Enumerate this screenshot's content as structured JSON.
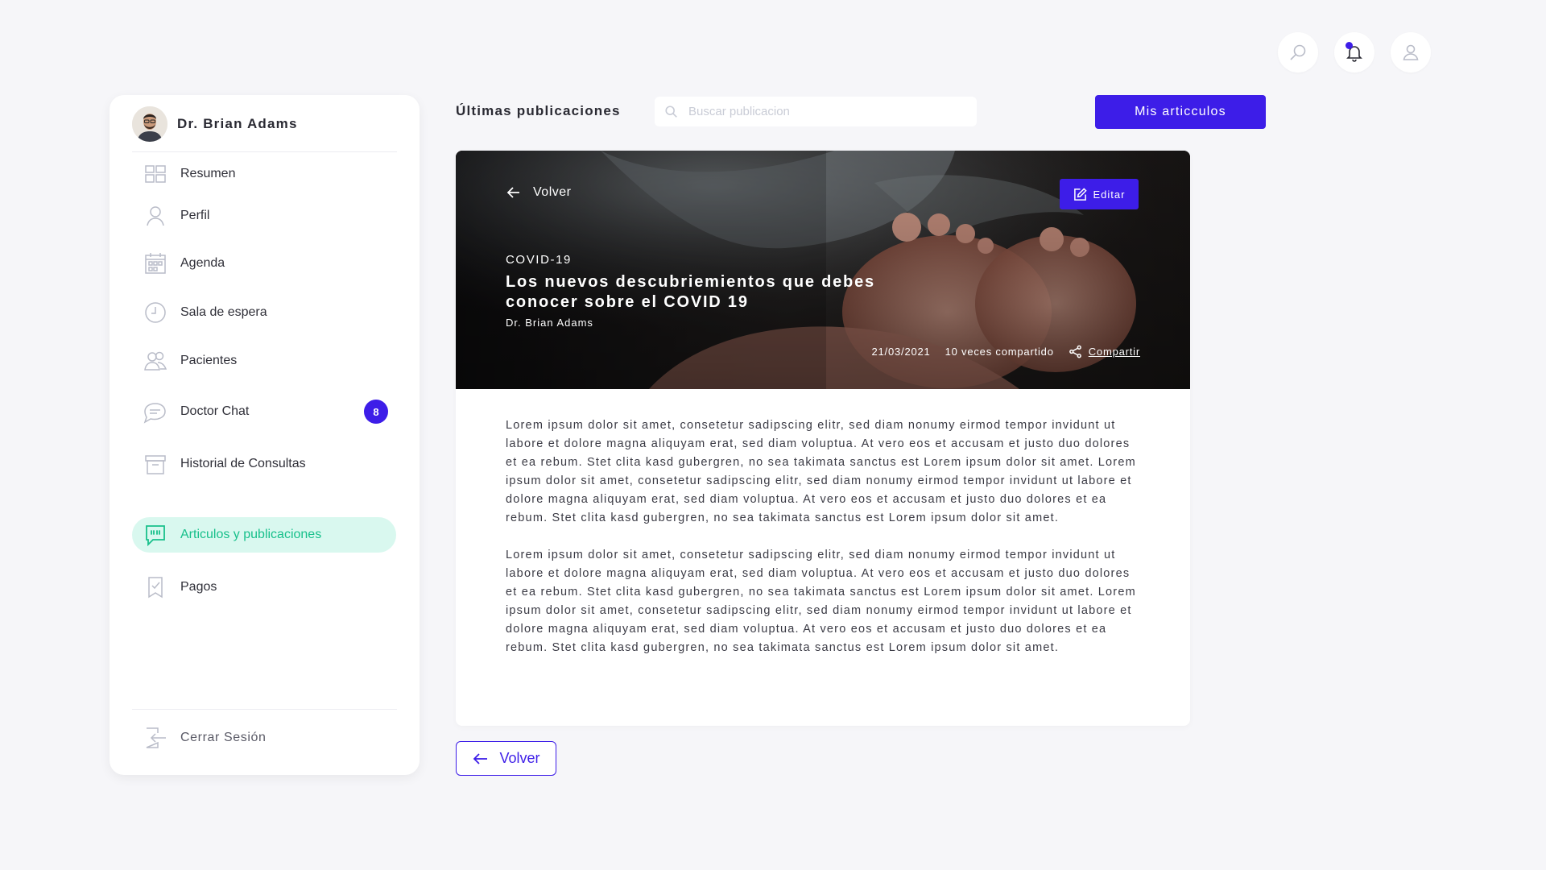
{
  "header": {
    "search_icon": "search-icon",
    "notifications_icon": "bell-icon",
    "notification_dot_color": "#3d1de8",
    "profile_icon": "user-icon"
  },
  "sidebar": {
    "user_name": "Dr. Brian Adams",
    "items": [
      {
        "label": "Resumen",
        "icon": "dashboard-icon"
      },
      {
        "label": "Perfil",
        "icon": "user-icon"
      },
      {
        "label": "Agenda",
        "icon": "calendar-icon"
      },
      {
        "label": "Sala de espera",
        "icon": "clock-icon"
      },
      {
        "label": "Pacientes",
        "icon": "users-icon"
      },
      {
        "label": "Doctor Chat",
        "icon": "chat-icon",
        "badge": "8"
      },
      {
        "label": "Historial de Consultas",
        "icon": "archive-icon"
      },
      {
        "label": "Articulos y publicaciones",
        "icon": "quote-icon",
        "active": true
      },
      {
        "label": "Pagos",
        "icon": "receipt-icon"
      }
    ],
    "logout_label": "Cerrar Sesión"
  },
  "main": {
    "section_title": "Últimas publicaciones",
    "search_placeholder": "Buscar publicacion",
    "my_articles_label": "Mis articculos",
    "article": {
      "back_label": "Volver",
      "edit_label": "Editar",
      "category": "COVID-19",
      "title": "Los nuevos descubriemientos que debes conocer sobre el COVID 19",
      "author": "Dr. Brian Adams",
      "date": "21/03/2021",
      "shares": "10 veces compartido",
      "share_label": "Compartir",
      "paragraphs": [
        "Lorem ipsum dolor sit amet, consetetur sadipscing elitr, sed diam nonumy eirmod tempor invidunt ut labore et dolore magna aliquyam erat, sed diam voluptua. At vero eos et accusam et justo duo dolores et ea rebum. Stet clita kasd gubergren, no sea takimata sanctus est Lorem ipsum dolor sit amet. Lorem ipsum dolor sit amet, consetetur sadipscing elitr, sed diam nonumy eirmod tempor invidunt ut labore et dolore magna aliquyam erat, sed diam voluptua. At vero eos et accusam et justo duo dolores et ea rebum. Stet clita kasd gubergren, no sea takimata sanctus est Lorem ipsum dolor sit amet.",
        "Lorem ipsum dolor sit amet, consetetur sadipscing elitr, sed diam nonumy eirmod tempor invidunt ut labore et dolore magna aliquyam erat, sed diam voluptua. At vero eos et accusam et justo duo dolores et ea rebum. Stet clita kasd gubergren, no sea takimata sanctus est Lorem ipsum dolor sit amet. Lorem ipsum dolor sit amet, consetetur sadipscing elitr, sed diam nonumy eirmod tempor invidunt ut labore et dolore magna aliquyam erat, sed diam voluptua. At vero eos et accusam et justo duo dolores et ea rebum. Stet clita kasd gubergren, no sea takimata sanctus est Lorem ipsum dolor sit amet."
      ]
    },
    "bottom_back_label": "Volver"
  },
  "colors": {
    "primary": "#3d1de8",
    "active_bg": "#d9f8ef",
    "active_text": "#18c08b"
  }
}
